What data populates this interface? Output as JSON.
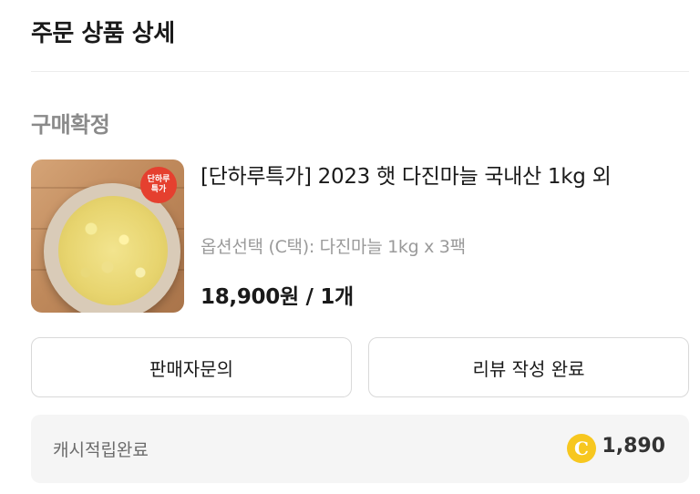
{
  "header": {
    "title": "주문 상품 상세"
  },
  "order": {
    "status": "구매확정",
    "product": {
      "badge": "단하루특가",
      "title": "[단하루특가] 2023 햇 다진마늘 국내산 1kg 외",
      "option": "옵션선택 (C택): 다진마늘 1kg x 3팩",
      "price": "18,900원 / 1개"
    },
    "buttons": {
      "inquiry": "판매자문의",
      "review": "리뷰 작성 완료"
    },
    "cashback": {
      "label": "캐시적립완료",
      "coin_symbol": "C",
      "amount": "1,890"
    }
  }
}
